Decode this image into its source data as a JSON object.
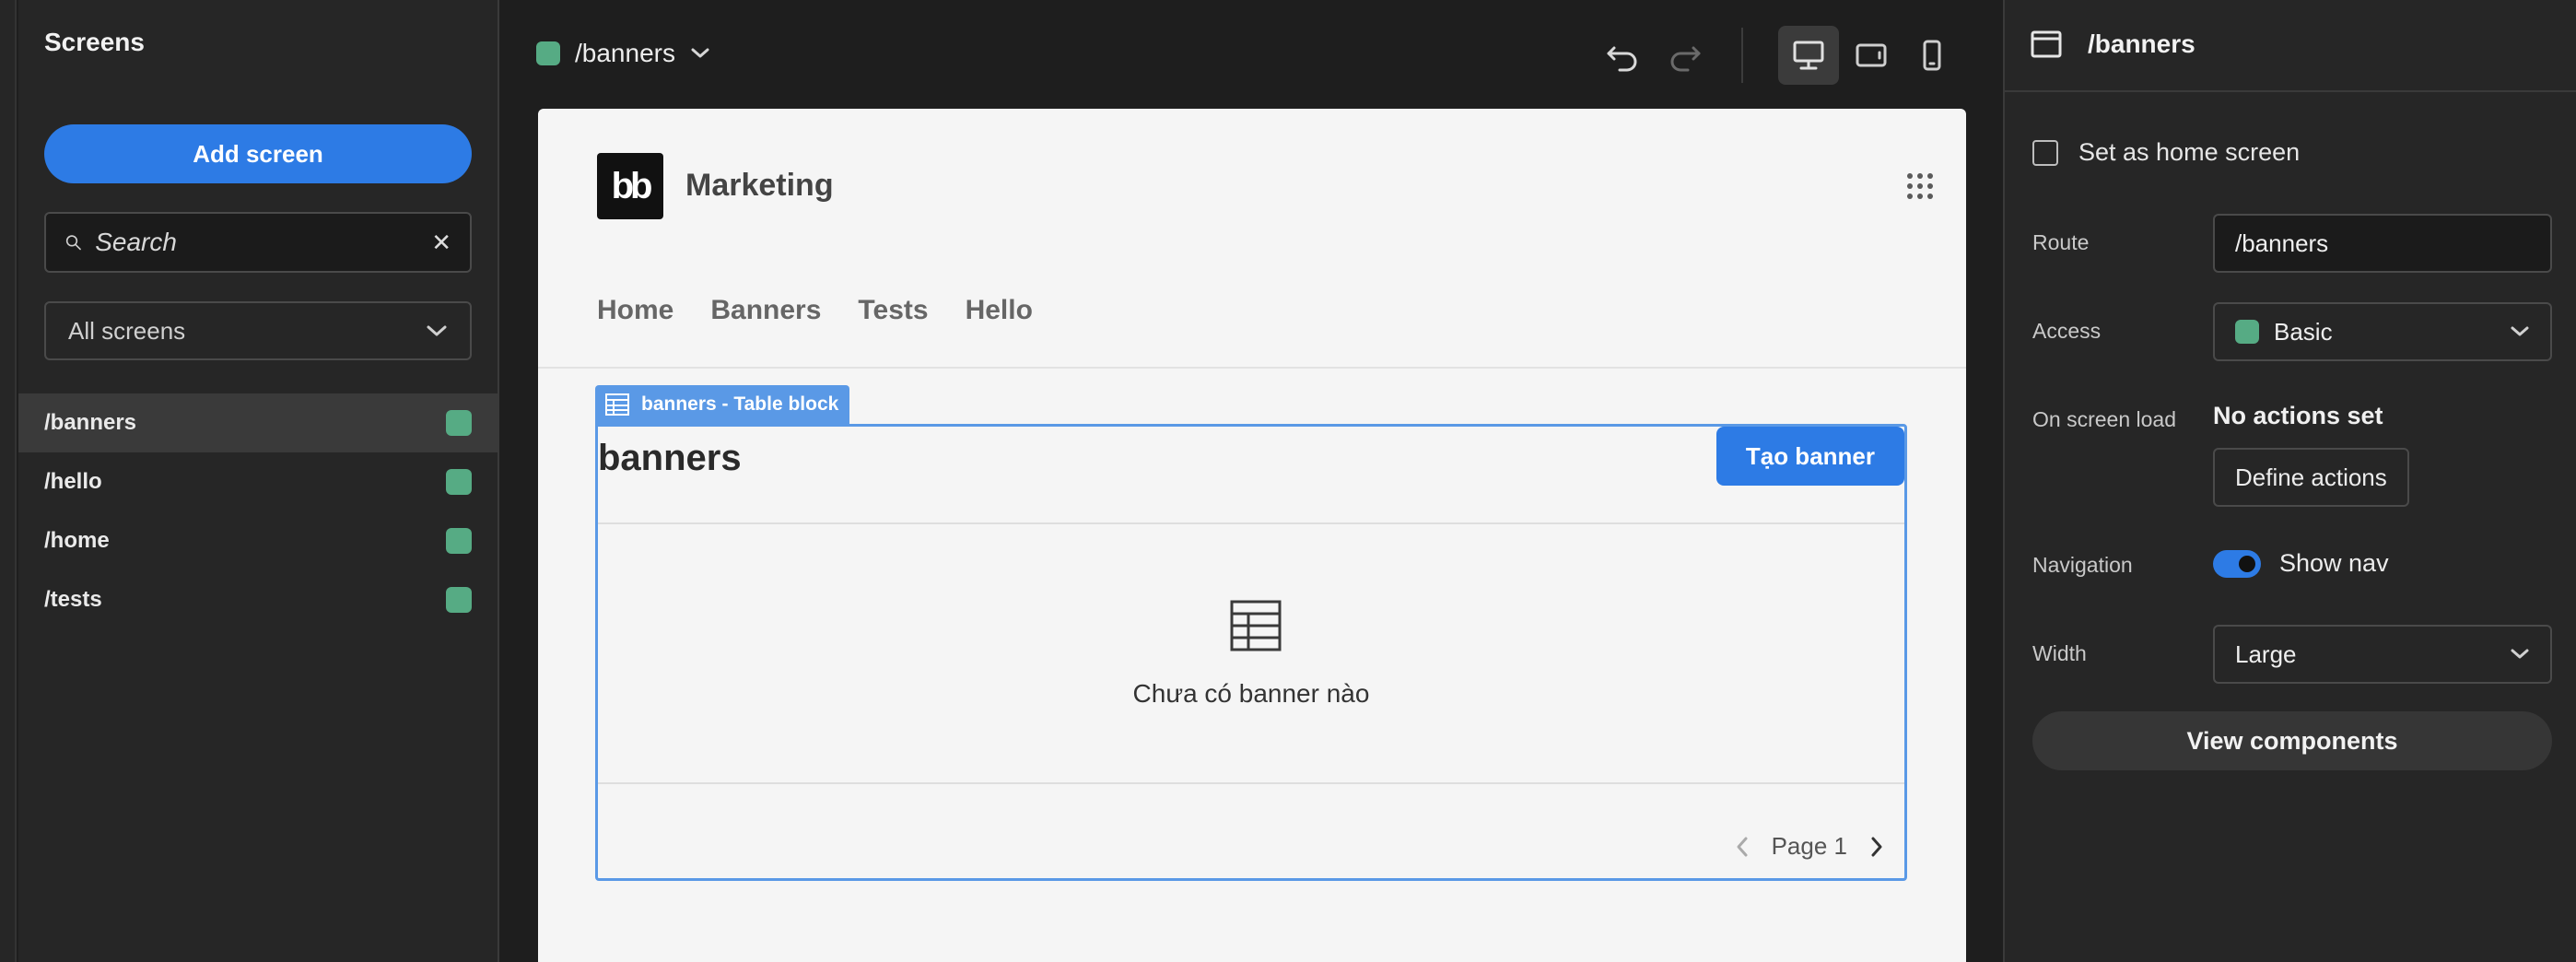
{
  "sidebar": {
    "title": "Screens",
    "add_button": "Add screen",
    "search_placeholder": "Search",
    "filter_value": "All screens",
    "screens": [
      {
        "route": "/banners",
        "active": true
      },
      {
        "route": "/hello"
      },
      {
        "route": "/home"
      },
      {
        "route": "/tests"
      }
    ]
  },
  "topbar": {
    "current_route": "/banners"
  },
  "preview": {
    "logo_text": "bb",
    "app_name": "Marketing",
    "nav": [
      "Home",
      "Banners",
      "Tests",
      "Hello"
    ],
    "block_tag": "banners - Table block",
    "table_title": "banners",
    "create_button": "Tạo banner",
    "empty_text": "Chưa có banner nào",
    "page_label": "Page 1"
  },
  "props": {
    "header_route": "/banners",
    "home_label": "Set as home screen",
    "route_label": "Route",
    "route_value": "/banners",
    "access_label": "Access",
    "access_value": "Basic",
    "onload_label": "On screen load",
    "onload_value": "No actions set",
    "define_button": "Define actions",
    "nav_label": "Navigation",
    "nav_toggle_label": "Show nav",
    "width_label": "Width",
    "width_value": "Large",
    "view_components": "View components"
  },
  "colors": {
    "accent": "#2d7be5",
    "role_dot": "#56ab84",
    "block_outline": "#5a99e6"
  }
}
